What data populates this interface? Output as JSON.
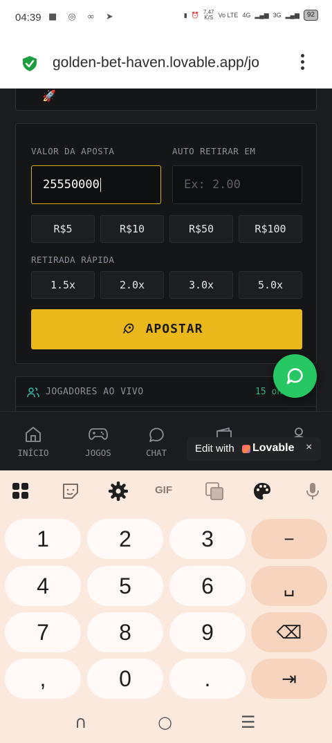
{
  "status_bar": {
    "time": "04:39",
    "speed": "7,47",
    "speed_unit": "K/S",
    "net1": "Vo LTE",
    "net2": "4G",
    "net3": "3G",
    "battery": "92"
  },
  "browser": {
    "url": "golden-bet-haven.lovable.app/jo"
  },
  "bet": {
    "amount_label": "VALOR DA APOSTA",
    "amount_value": "25550000",
    "auto_label": "AUTO RETIRAR EM",
    "auto_placeholder": "Ex: 2.00",
    "amount_chips": [
      "R$5",
      "R$10",
      "R$50",
      "R$100"
    ],
    "quick_label": "RETIRADA RÁPIDA",
    "quick_chips": [
      "1.5x",
      "2.0x",
      "3.0x",
      "5.0x"
    ],
    "apostar": "APOSTAR"
  },
  "players": {
    "title": "JOGADORES AO VIVO",
    "online": "15 on"
  },
  "nav": {
    "items": [
      "INÍCIO",
      "JOGOS",
      "CHAT"
    ]
  },
  "lovable": {
    "edit_with": "Edit with",
    "brand": "Lovable",
    "close": "×"
  },
  "keyboard": {
    "gif": "GIF",
    "keys": [
      "1",
      "2",
      "3",
      "4",
      "5",
      "6",
      "7",
      "8",
      "9",
      ",",
      "0",
      "."
    ],
    "side_keys": [
      "−",
      "␣",
      "⌫",
      "⇥"
    ],
    "sysnav": [
      "∩",
      "○",
      "☰"
    ]
  }
}
